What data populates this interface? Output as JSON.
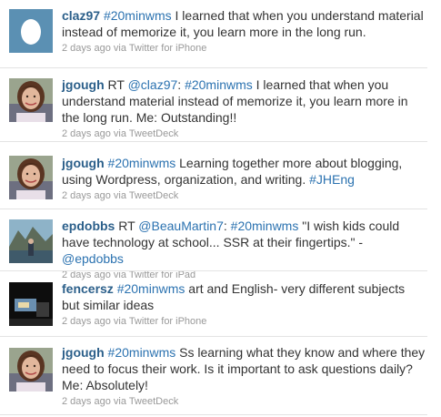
{
  "tweets": [
    {
      "user": "claz97",
      "avatar": "egg-avatar-icon",
      "text": [
        {
          "t": "hashtag",
          "v": "#20minwms"
        },
        {
          "t": "text",
          "v": " I learned that when you understand material instead of memorize it, you learn more in the long run."
        }
      ],
      "time": "2 days ago",
      "via_label": "via",
      "source": "Twitter for iPhone"
    },
    {
      "user": "jgough",
      "avatar": "woman-portrait-avatar",
      "text": [
        {
          "t": "text",
          "v": "RT "
        },
        {
          "t": "mention",
          "v": "@claz97"
        },
        {
          "t": "text",
          "v": ": "
        },
        {
          "t": "hashtag",
          "v": "#20minwms"
        },
        {
          "t": "text",
          "v": " I learned that when you understand material instead of memorize it, you learn more in the long run. Me: Outstanding!!"
        }
      ],
      "time": "2 days ago",
      "via_label": "via",
      "source": "TweetDeck"
    },
    {
      "user": "jgough",
      "avatar": "woman-portrait-avatar",
      "text": [
        {
          "t": "hashtag",
          "v": "#20minwms"
        },
        {
          "t": "text",
          "v": " Learning together more about blogging, using Wordpress, organization, and writing. "
        },
        {
          "t": "hashtag",
          "v": "#JHEng"
        }
      ],
      "time": "2 days ago",
      "via_label": "via",
      "source": "TweetDeck"
    },
    {
      "user": "epdobbs",
      "avatar": "outdoor-photo-avatar",
      "text": [
        {
          "t": "text",
          "v": "RT "
        },
        {
          "t": "mention",
          "v": "@BeauMartin7"
        },
        {
          "t": "text",
          "v": ": "
        },
        {
          "t": "hashtag",
          "v": "#20minwms"
        },
        {
          "t": "text",
          "v": " \"I wish kids could have technology at school... SSR at their fingertips.\" - "
        },
        {
          "t": "mention",
          "v": "@epdobbs"
        }
      ],
      "time": "2 days ago",
      "via_label": "via",
      "source": "Twitter for iPad"
    },
    {
      "user": "fencersz",
      "avatar": "dark-photo-avatar",
      "text": [
        {
          "t": "hashtag",
          "v": "#20minwms"
        },
        {
          "t": "text",
          "v": " art and English- very different subjects but similar ideas"
        }
      ],
      "time": "2 days ago",
      "via_label": "via",
      "source": "Twitter for iPhone"
    },
    {
      "user": "jgough",
      "avatar": "woman-portrait-avatar",
      "text": [
        {
          "t": "hashtag",
          "v": "#20minwms"
        },
        {
          "t": "text",
          "v": " Ss learning what they know and where they need to focus their work. Is it important to ask questions daily? Me: Absolutely!"
        }
      ],
      "time": "2 days ago",
      "via_label": "via",
      "source": "TweetDeck"
    }
  ],
  "colors": {
    "screen_name": "#2b5f8a",
    "link": "#2b72b0",
    "meta": "#999999",
    "separator": "#e3e3e3"
  }
}
